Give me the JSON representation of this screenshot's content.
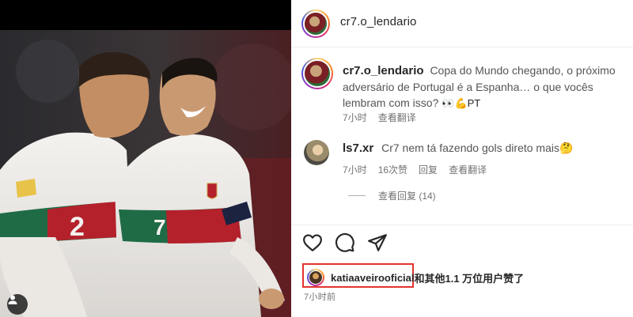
{
  "post": {
    "author": "cr7.o_lendario"
  },
  "caption": {
    "username": "cr7.o_lendario",
    "text": "Copa do Mundo chegando, o próximo adversário de Portugal é a Espanha… o que vocês lembram com isso?",
    "emojis": "👀💪PT",
    "time": "7小时",
    "translate": "查看翻译"
  },
  "comment": {
    "username": "ls7.xr",
    "text": "Cr7 nem tá fazendo gols direto mais🤔",
    "time": "7小时",
    "likes": "16次赞",
    "reply": "回复",
    "translate": "查看翻译",
    "view_replies": "查看回复 (14)"
  },
  "likes": {
    "username": "katiaaveirooficial",
    "rest": "和其他1.1 万位用户赞了"
  },
  "post_time": "7小时前",
  "icons": [
    "heart-icon",
    "comment-icon",
    "share-icon",
    "user-tag-icon"
  ],
  "colors": {
    "highlight_border": "#e3342f",
    "secondary_text": "#737373"
  }
}
